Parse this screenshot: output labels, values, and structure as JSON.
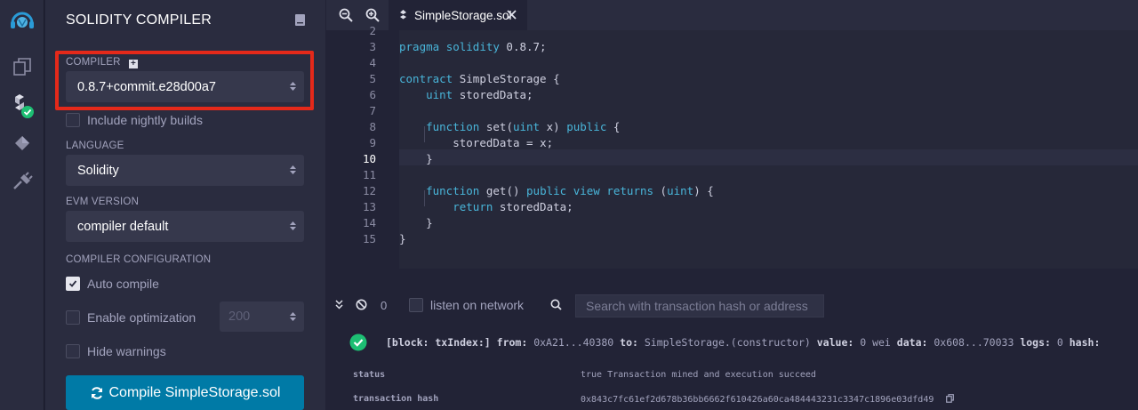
{
  "rail": {
    "icons": [
      "remix-logo-icon",
      "file-explorer-icon",
      "solidity-compiler-icon",
      "deploy-run-icon",
      "plugin-manager-icon"
    ]
  },
  "panel": {
    "title": "SOLIDITY COMPILER",
    "compiler_label": "COMPILER",
    "compiler_value": "0.8.7+commit.e28d00a7",
    "nightly_label": "Include nightly builds",
    "language_label": "LANGUAGE",
    "language_value": "Solidity",
    "evm_label": "EVM VERSION",
    "evm_value": "compiler default",
    "config_label": "COMPILER CONFIGURATION",
    "auto_compile_label": "Auto compile",
    "auto_compile_checked": true,
    "optimization_label": "Enable optimization",
    "optimization_runs": "200",
    "hide_warnings_label": "Hide warnings",
    "compile_button": "Compile SimpleStorage.sol"
  },
  "editor": {
    "tab_name": "SimpleStorage.sol",
    "current_line": "10",
    "lines": [
      {
        "n": "2",
        "code": ""
      },
      {
        "n": "3",
        "code": "pragma solidity 0.8.7;"
      },
      {
        "n": "4",
        "code": ""
      },
      {
        "n": "5",
        "code": "contract SimpleStorage {"
      },
      {
        "n": "6",
        "code": "    uint storedData;"
      },
      {
        "n": "7",
        "code": ""
      },
      {
        "n": "8",
        "code": "    function set(uint x) public {"
      },
      {
        "n": "9",
        "code": "        storedData = x;"
      },
      {
        "n": "10",
        "code": "    }"
      },
      {
        "n": "11",
        "code": ""
      },
      {
        "n": "12",
        "code": "    function get() public view returns (uint) {"
      },
      {
        "n": "13",
        "code": "        return storedData;"
      },
      {
        "n": "14",
        "code": "    }"
      },
      {
        "n": "15",
        "code": "}"
      }
    ]
  },
  "terminal": {
    "count": "0",
    "listen_label": "listen on network",
    "search_placeholder": "Search with transaction hash or address",
    "log": {
      "block": "[block: txIndex:]",
      "from_label": "from:",
      "from_value": "0xA21...40380",
      "to_label": "to:",
      "to_value": "SimpleStorage.(constructor)",
      "value_label": "value:",
      "value_value": "0 wei",
      "data_label": "data:",
      "data_value": "0x608...70033",
      "logs_label": "logs:",
      "logs_value": "0",
      "hash_label": "hash:"
    },
    "rows": [
      {
        "key": "status",
        "value": "true Transaction mined and execution succeed"
      },
      {
        "key": "transaction hash",
        "value": "0x843c7fc61ef2d678b36bb6662f610426a60ca484443231c3347c1896e03dfd49"
      }
    ]
  },
  "colors": {
    "accent": "#007aa6",
    "highlight": "#e4291a",
    "success": "#1dbf73"
  }
}
